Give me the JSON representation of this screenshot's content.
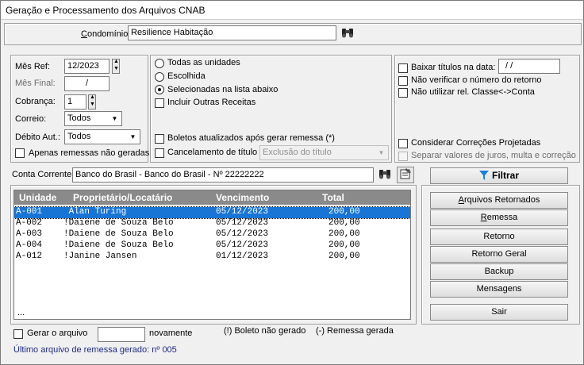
{
  "title": "Geração e Processamento dos Arquivos CNAB",
  "condominio": {
    "label": "Condomínio:",
    "value": "Resilience Habitação"
  },
  "filters": {
    "mes_ref": {
      "label": "Mês Ref:",
      "value": "12/2023"
    },
    "mes_final": {
      "label": "Mês Final:",
      "value": "/"
    },
    "cobranca": {
      "label": "Cobrança:",
      "value": "1"
    },
    "correio": {
      "label": "Correio:",
      "value": "Todos"
    },
    "debito_aut": {
      "label": "Débito Aut.:",
      "value": "Todos"
    },
    "apenas_remessas": "Apenas remessas não geradas"
  },
  "units": {
    "todas": "Todas as unidades",
    "escolhida": "Escolhida",
    "selecionadas": "Selecionadas na lista abaixo",
    "incluir": "Incluir Outras Receitas",
    "boletos": "Boletos atualizados após gerar remessa (*)",
    "cancelamento": "Cancelamento de título",
    "cancelamento_value": "Exclusão do título"
  },
  "options": {
    "baixar": "Baixar títulos na data:",
    "baixar_value": "/ /",
    "nao_verificar": "Não verificar o número do retorno",
    "nao_utilizar": "Não utilizar rel. Classe<->Conta",
    "considerar": "Considerar Correções Projetadas",
    "separar": "Separar valores de juros, multa e correção"
  },
  "conta": {
    "label": "Conta Corrente:",
    "value": "Banco do Brasil - Banco do Brasil - Nº 22222222"
  },
  "buttons": {
    "filtrar": "Filtrar",
    "arquivos_retornados": "Arquivos Retornados",
    "remessa": "Remessa",
    "retorno": "Retorno",
    "retorno_geral": "Retorno Geral",
    "backup": "Backup",
    "mensagens": "Mensagens",
    "sair": "Sair"
  },
  "table": {
    "headers": [
      "Unidade",
      "Proprietário/Locatário",
      "Vencimento",
      "Total"
    ],
    "rows": [
      [
        "A-001",
        " Alan Turing",
        "05/12/2023",
        "200,00"
      ],
      [
        "A-002",
        "!Daiene de Souza Belo",
        "05/12/2023",
        "200,00"
      ],
      [
        "A-003",
        "!Daiene de Souza Belo",
        "05/12/2023",
        "200,00"
      ],
      [
        "A-004",
        "!Daiene de Souza Belo",
        "05/12/2023",
        "200,00"
      ],
      [
        "A-012",
        "!Janine Jansen",
        "01/12/2023",
        "200,00"
      ]
    ],
    "ellipsis": "..."
  },
  "footer": {
    "gerar": "Gerar o arquivo",
    "novamente": "novamente",
    "legend1": "(!) Boleto não gerado",
    "legend2": "(-) Remessa gerada",
    "ultimo": "Último arquivo de remessa gerado: nº 005"
  },
  "colors": {
    "selection": "#1874d5",
    "header": "#8a8a8a",
    "info_text": "#1c2a88"
  },
  "icons": {
    "search": "binoculars-icon",
    "filter": "funnel-icon",
    "edit": "edit-icon"
  }
}
